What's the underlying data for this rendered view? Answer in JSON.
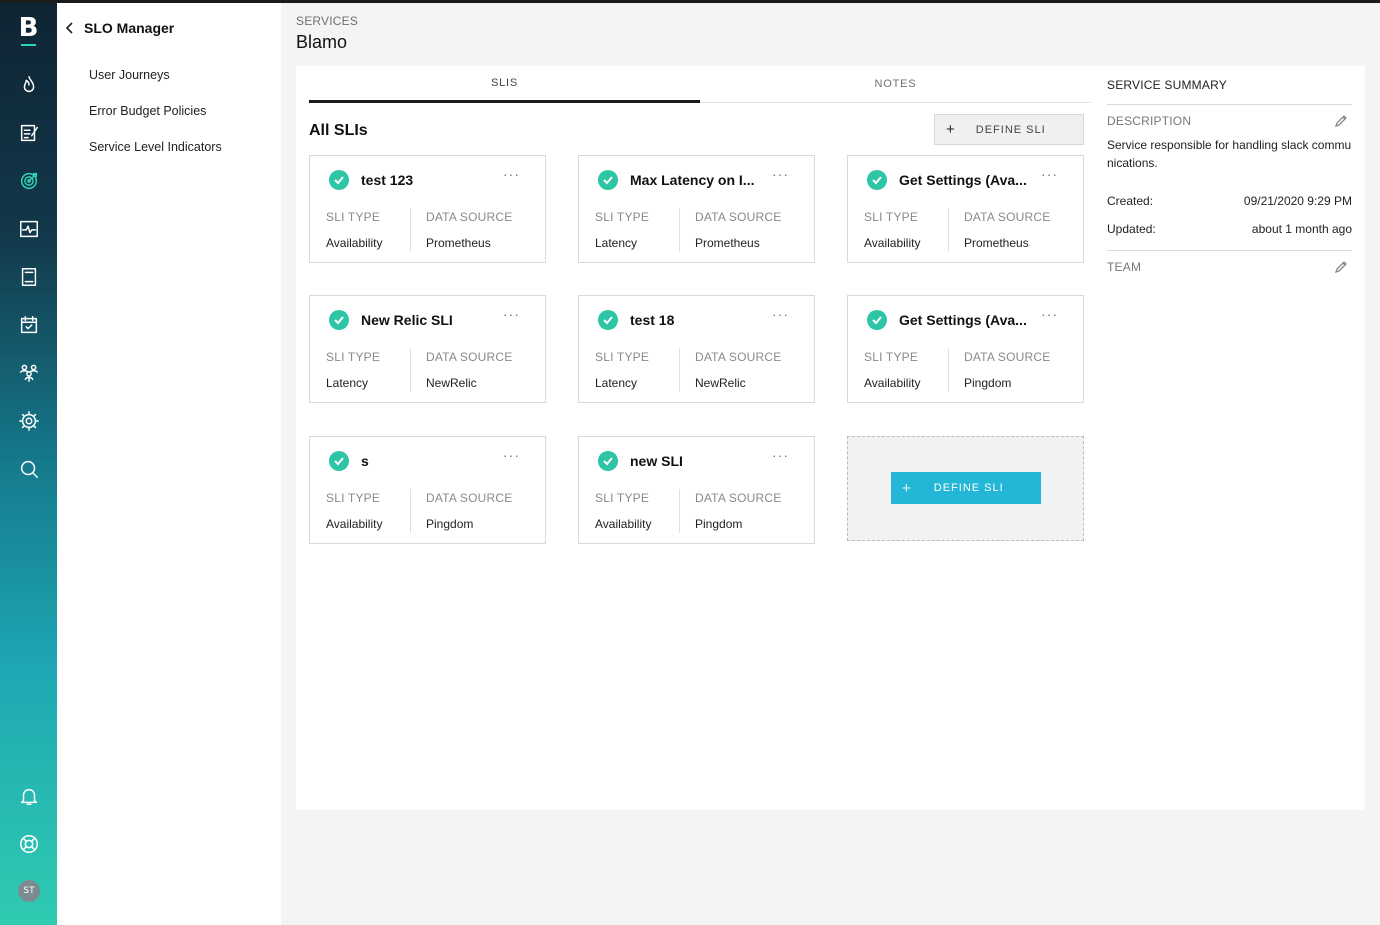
{
  "rail": {
    "logo": "B",
    "icons": [
      "flame-icon",
      "edit-document-icon",
      "target-icon",
      "pulse-monitor-icon",
      "notebook-icon",
      "calendar-check-icon",
      "team-icon",
      "gear-icon",
      "search-icon",
      "bell-icon",
      "lifebuoy-icon"
    ],
    "avatar_initials": "ST"
  },
  "subnav": {
    "title": "SLO Manager",
    "items": [
      {
        "label": "User Journeys"
      },
      {
        "label": "Error Budget Policies"
      },
      {
        "label": "Service Level Indicators"
      }
    ]
  },
  "header": {
    "breadcrumb": "SERVICES",
    "title": "Blamo"
  },
  "tabs": [
    {
      "label": "SLIS",
      "active": true
    },
    {
      "label": "NOTES",
      "active": false
    }
  ],
  "sli_section": {
    "title": "All SLIs",
    "define_button": "DEFINE SLI",
    "type_label": "SLI TYPE",
    "source_label": "DATA SOURCE",
    "more_glyph": "···",
    "cards": [
      {
        "name": "test 123",
        "type": "Availability",
        "source": "Prometheus"
      },
      {
        "name": "Max Latency on I...",
        "type": "Latency",
        "source": "Prometheus"
      },
      {
        "name": "Get Settings (Ava...",
        "type": "Availability",
        "source": "Prometheus"
      },
      {
        "name": "New Relic SLI",
        "type": "Latency",
        "source": "NewRelic"
      },
      {
        "name": "test 18",
        "type": "Latency",
        "source": "NewRelic"
      },
      {
        "name": "Get Settings (Ava...",
        "type": "Availability",
        "source": "Pingdom"
      },
      {
        "name": "s",
        "type": "Availability",
        "source": "Pingdom"
      },
      {
        "name": "new SLI",
        "type": "Availability",
        "source": "Pingdom"
      }
    ],
    "add_card_button": "DEFINE SLI"
  },
  "summary": {
    "title": "SERVICE SUMMARY",
    "description_label": "DESCRIPTION",
    "description": "Service responsible for handling slack communications.",
    "created_label": "Created:",
    "created_value": "09/21/2020 9:29 PM",
    "updated_label": "Updated:",
    "updated_value": "about 1 month ago",
    "team_label": "TEAM"
  },
  "colors": {
    "accent": "#23b6d6",
    "check": "#2ec4a6"
  }
}
